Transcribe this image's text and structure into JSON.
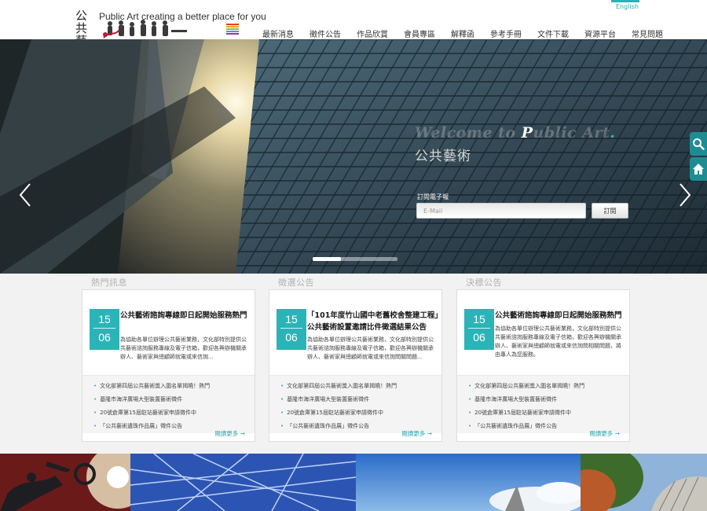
{
  "header": {
    "lang_link": "English",
    "logo_cn": "公共藝術",
    "logo_en": "Public Art creating a better place for you",
    "nav": [
      "最新消息",
      "徵件公告",
      "作品欣賞",
      "會員專區",
      "解釋函",
      "參考手冊",
      "文件下載",
      "資源平台",
      "常見問題"
    ]
  },
  "hero": {
    "welcome_pre": "Welcome to ",
    "welcome_p": "P",
    "welcome_rest": "ublic Art",
    "welcome_dot": ".",
    "welcome_cn": "公共藝術",
    "subscribe_label": "訂閱電子報",
    "email_placeholder": "E-Mail",
    "subscribe_button": "訂閱"
  },
  "sections": [
    {
      "title": "熱門訊息",
      "date_top": "15",
      "date_bottom": "06",
      "headline": "公共藝術諮詢專線即日起開始服務熱門",
      "excerpt": "為協助各單位辦理公共藝術業務，文化部特別提供公共藝術諮詢服務專線及電子信箱，歡迎各興辦機關承辦人、藝術家與總顧師就電或來信詢...",
      "items": [
        "文化部第四屆公共藝術獎入圍名單揭曉！熱門",
        "基隆市海洋廣場大型裝置藝術徵件",
        "20號倉庫第15屆駐站藝術家申請徵件中",
        "「公共藝術遺珠作品展」徵件公告"
      ],
      "more": "閱讀更多"
    },
    {
      "title": "徵選公告",
      "date_top": "15",
      "date_bottom": "06",
      "headline": "「101年度竹山國中老舊校舍整建工程」公共藝術設置邀請比件徵選結果公告",
      "excerpt": "為協助各單位辦理公共藝術業務，文化部特別提供公共藝術諮詢服務專線及電子信箱，歡迎各興辦機關承辦人、藝術家與總顧師就電或來信詢問關問題...",
      "items": [
        "文化部第四屆公共藝術獎入圍名單揭曉！熱門",
        "基隆市海洋廣場大型裝置藝術徵件",
        "20號倉庫第15屆駐站藝術家申請徵件中",
        "「公共藝術遺珠作品展」徵件公告"
      ],
      "more": "閱讀更多"
    },
    {
      "title": "決標公告",
      "date_top": "15",
      "date_bottom": "06",
      "headline": "公共藝術諮詢專線即日起開始服務熱門",
      "excerpt": "為協助各單位辦理公共藝術業務，文化部特別提供公共藝術諮詢服務專線及電子信箱，歡迎各興辦機關承辦人、藝術家與總顧師就電或來信詢問相關問題，將由專人為您服務。",
      "items": [
        "文化部第四屆公共藝術獎入圍名單揭曉！熱門",
        "基隆市海洋廣場大型裝置藝術徵件",
        "20號倉庫第15屆駐站藝術家申請徵件中",
        "「公共藝術遺珠作品展」徵件公告"
      ],
      "more": "閱讀更多"
    }
  ],
  "colors": {
    "accent": "#2bb4b7",
    "tool_bg": "#1e8d93"
  },
  "icons": {
    "prev": "chevron-left-icon",
    "next": "chevron-right-icon",
    "search": "search-icon",
    "home": "home-icon"
  }
}
